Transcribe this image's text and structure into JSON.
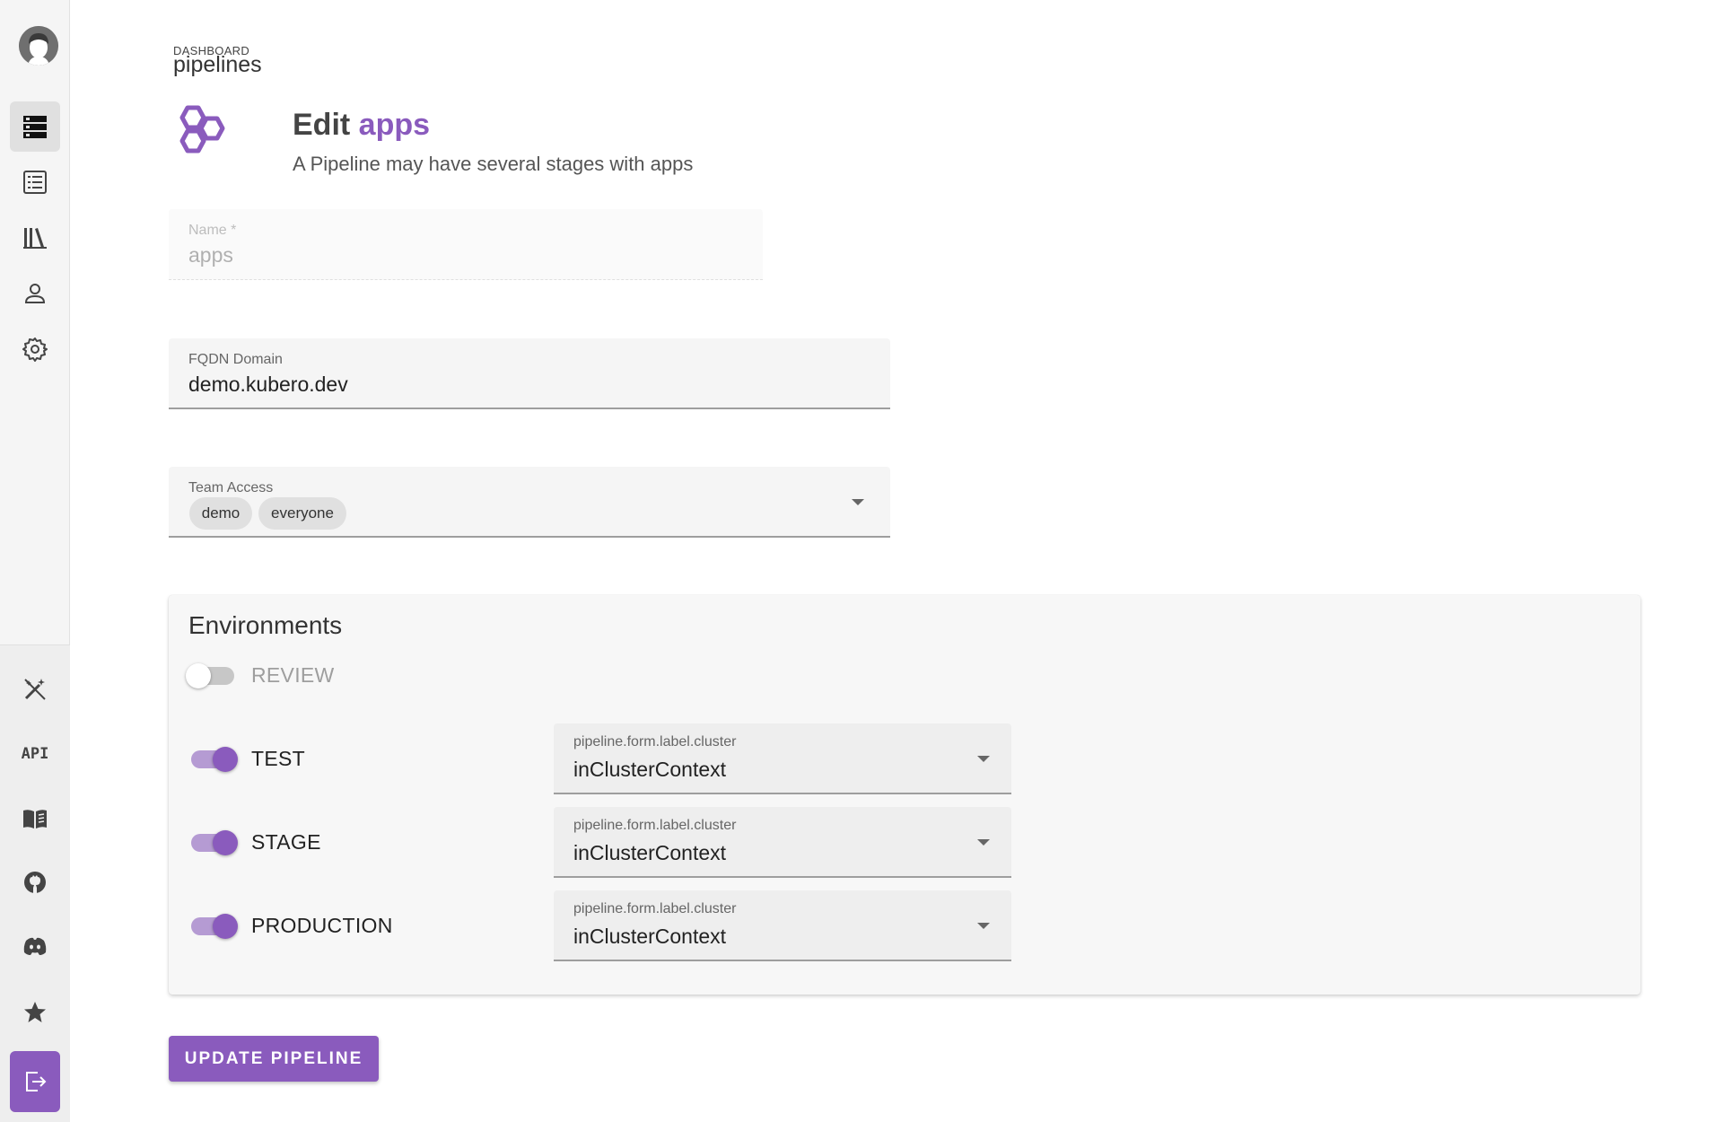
{
  "sidebar": {
    "top_items": [
      {
        "icon": "pipelines-icon",
        "active": true
      },
      {
        "icon": "list-icon",
        "active": false
      },
      {
        "icon": "library-icon",
        "active": false
      },
      {
        "icon": "user-icon",
        "active": false
      },
      {
        "icon": "gear-icon",
        "active": false
      }
    ],
    "bottom_items": [
      {
        "icon": "magic-wand-icon"
      },
      {
        "icon": "api-icon",
        "label": "API"
      },
      {
        "icon": "book-icon"
      },
      {
        "icon": "github-icon"
      },
      {
        "icon": "discord-icon"
      },
      {
        "icon": "star-icon"
      },
      {
        "icon": "logout-icon"
      }
    ]
  },
  "breadcrumb": {
    "small": "DASHBOARD",
    "big": "pipelines"
  },
  "header": {
    "title_prefix": "Edit",
    "title_accent": "apps",
    "subtitle": "A Pipeline may have several stages with apps"
  },
  "form": {
    "name": {
      "label": "Name *",
      "value": "apps"
    },
    "domain": {
      "label": "FQDN Domain",
      "value": "demo.kubero.dev"
    },
    "team_access": {
      "label": "Team Access",
      "chips": [
        "demo",
        "everyone"
      ]
    }
  },
  "environments": {
    "title": "Environments",
    "items": [
      {
        "label": "REVIEW",
        "enabled": false
      },
      {
        "label": "TEST",
        "enabled": true,
        "cluster_label": "pipeline.form.label.cluster",
        "cluster_value": "inClusterContext"
      },
      {
        "label": "STAGE",
        "enabled": true,
        "cluster_label": "pipeline.form.label.cluster",
        "cluster_value": "inClusterContext"
      },
      {
        "label": "PRODUCTION",
        "enabled": true,
        "cluster_label": "pipeline.form.label.cluster",
        "cluster_value": "inClusterContext"
      }
    ]
  },
  "actions": {
    "update_label": "UPDATE PIPELINE"
  },
  "colors": {
    "accent": "#8a5bbd",
    "accent_light": "#b59bd3"
  }
}
